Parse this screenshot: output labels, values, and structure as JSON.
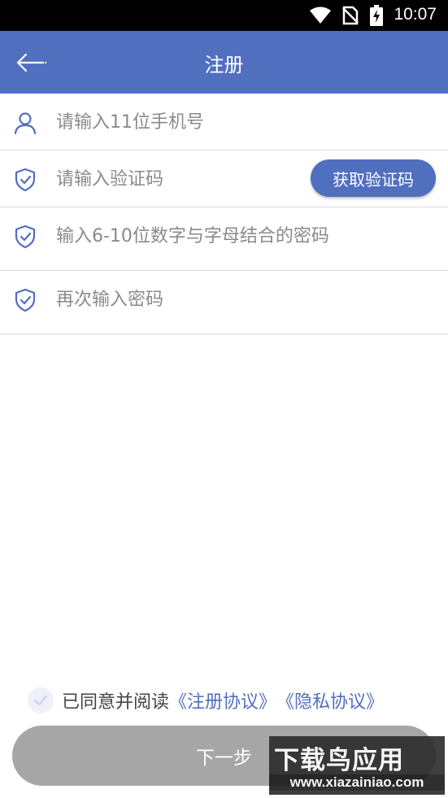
{
  "status_bar": {
    "time": "10:07",
    "icons": [
      "wifi-icon",
      "no-sim-icon",
      "battery-charging-icon"
    ]
  },
  "app_bar": {
    "title": "注册",
    "back_icon": "arrow-left-icon",
    "color": "#516fbf"
  },
  "form": {
    "phone": {
      "icon": "user-icon",
      "placeholder": "请输入11位手机号",
      "value": ""
    },
    "code": {
      "icon": "shield-check-icon",
      "placeholder": "请输入验证码",
      "value": "",
      "button_label": "获取验证码"
    },
    "password": {
      "icon": "shield-check-icon",
      "placeholder": "输入6-10位数字与字母结合的密码",
      "value": ""
    },
    "confirm": {
      "icon": "shield-check-icon",
      "placeholder": "再次输入密码",
      "value": ""
    }
  },
  "agreement": {
    "text": "已同意并阅读",
    "link_register": "《注册协议》",
    "link_privacy": "《隐私协议》"
  },
  "next_button": {
    "label": "下一步",
    "enabled": false
  },
  "watermark": {
    "title": "下载鸟应用",
    "url": "www.xiazainiao.com"
  }
}
